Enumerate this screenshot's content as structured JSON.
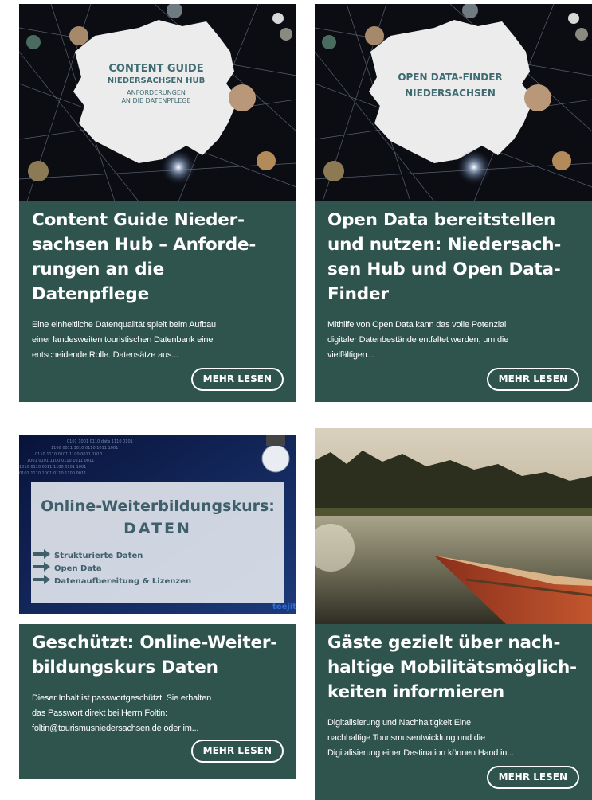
{
  "colors": {
    "panel": "#2f534d",
    "text": "#ffffff"
  },
  "cards": [
    {
      "image": {
        "line1": "CONTENT GUIDE",
        "line2": "NIEDERSACHSEN HUB",
        "line3": "ANFORDERUNGEN",
        "line4": "AN DIE DATENPFLEGE"
      },
      "title_lines": [
        "Content Guide Nieder-",
        "sachsen Hub – Anforde-",
        "rungen an die",
        "Datenpflege"
      ],
      "excerpt_lines": [
        "Eine einheitliche Datenqualität spielt beim Aufbau",
        "einer landesweiten touristischen Datenbank eine",
        "entscheidende Rolle. Datensätze aus..."
      ],
      "button": "MEHR LESEN"
    },
    {
      "image": {
        "line1": "OPEN DATA-FINDER",
        "line2": "NIEDERSACHSEN"
      },
      "title_lines": [
        "Open Data bereitstellen",
        "und nutzen: Niedersach-",
        "sen Hub und Open Data-",
        "Finder"
      ],
      "excerpt_lines": [
        "Mithilfe von Open Data kann das volle Potenzial",
        "digitaler Datenbestände entfaltet werden, um die",
        "vielfältigen..."
      ],
      "button": "MEHR LESEN"
    },
    {
      "image": {
        "heading": "Online-Weiterbildungskurs:",
        "subheading": "DATEN",
        "items": [
          "Strukturierte Daten",
          "Open Data",
          "Datenaufbereitung & Lizenzen"
        ],
        "logo": "teejit"
      },
      "title_lines": [
        "Geschützt: Online-Weiter-",
        "bildungskurs Daten"
      ],
      "excerpt_lines": [
        "Dieser Inhalt ist passwortgeschützt. Sie erhalten",
        "das Passwort direkt bei Herrn Foltin:",
        "foltin@tourismusniedersachsen.de oder im..."
      ],
      "button": "MEHR LESEN"
    },
    {
      "image": {},
      "title_lines": [
        "Gäste gezielt über nach-",
        "haltige Mobilitätsmöglich-",
        "keiten informieren"
      ],
      "excerpt_lines": [
        "  Digitalisierung und Nachhaltigkeit Eine",
        "nachhaltige Tourismusentwicklung und die",
        "Digitalisierung einer Destination können Hand in..."
      ],
      "button": "MEHR LESEN"
    }
  ]
}
